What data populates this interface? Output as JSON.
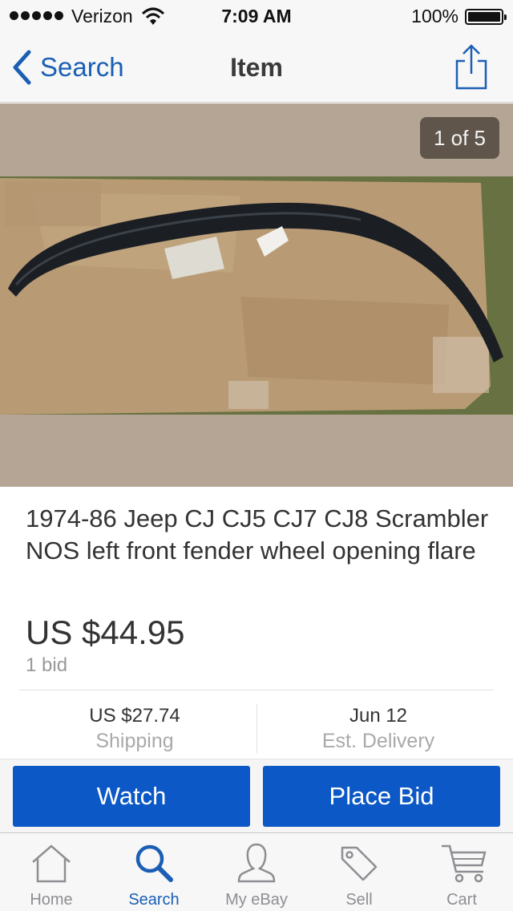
{
  "status_bar": {
    "carrier": "Verizon",
    "time": "7:09 AM",
    "battery": "100%"
  },
  "nav": {
    "back_label": "Search",
    "title": "Item"
  },
  "gallery": {
    "counter": "1 of 5"
  },
  "item": {
    "title": "1974-86 Jeep CJ CJ5 CJ7 CJ8 Scrambler NOS left front fender wheel opening flare",
    "price": "US $44.95",
    "bids": "1 bid",
    "shipping_cost": "US $27.74",
    "shipping_label": "Shipping",
    "delivery_date": "Jun 12",
    "delivery_label": "Est. Delivery"
  },
  "actions": {
    "watch_label": "Watch",
    "bid_label": "Place Bid"
  },
  "tabs": [
    {
      "label": "Home",
      "icon": "home-icon"
    },
    {
      "label": "Search",
      "icon": "search-icon",
      "active": true
    },
    {
      "label": "My eBay",
      "icon": "person-icon"
    },
    {
      "label": "Sell",
      "icon": "tag-icon"
    },
    {
      "label": "Cart",
      "icon": "cart-icon"
    }
  ],
  "colors": {
    "accent": "#1a5fb4",
    "button": "#0b58c6",
    "gallery_bg": "#b5a595"
  }
}
